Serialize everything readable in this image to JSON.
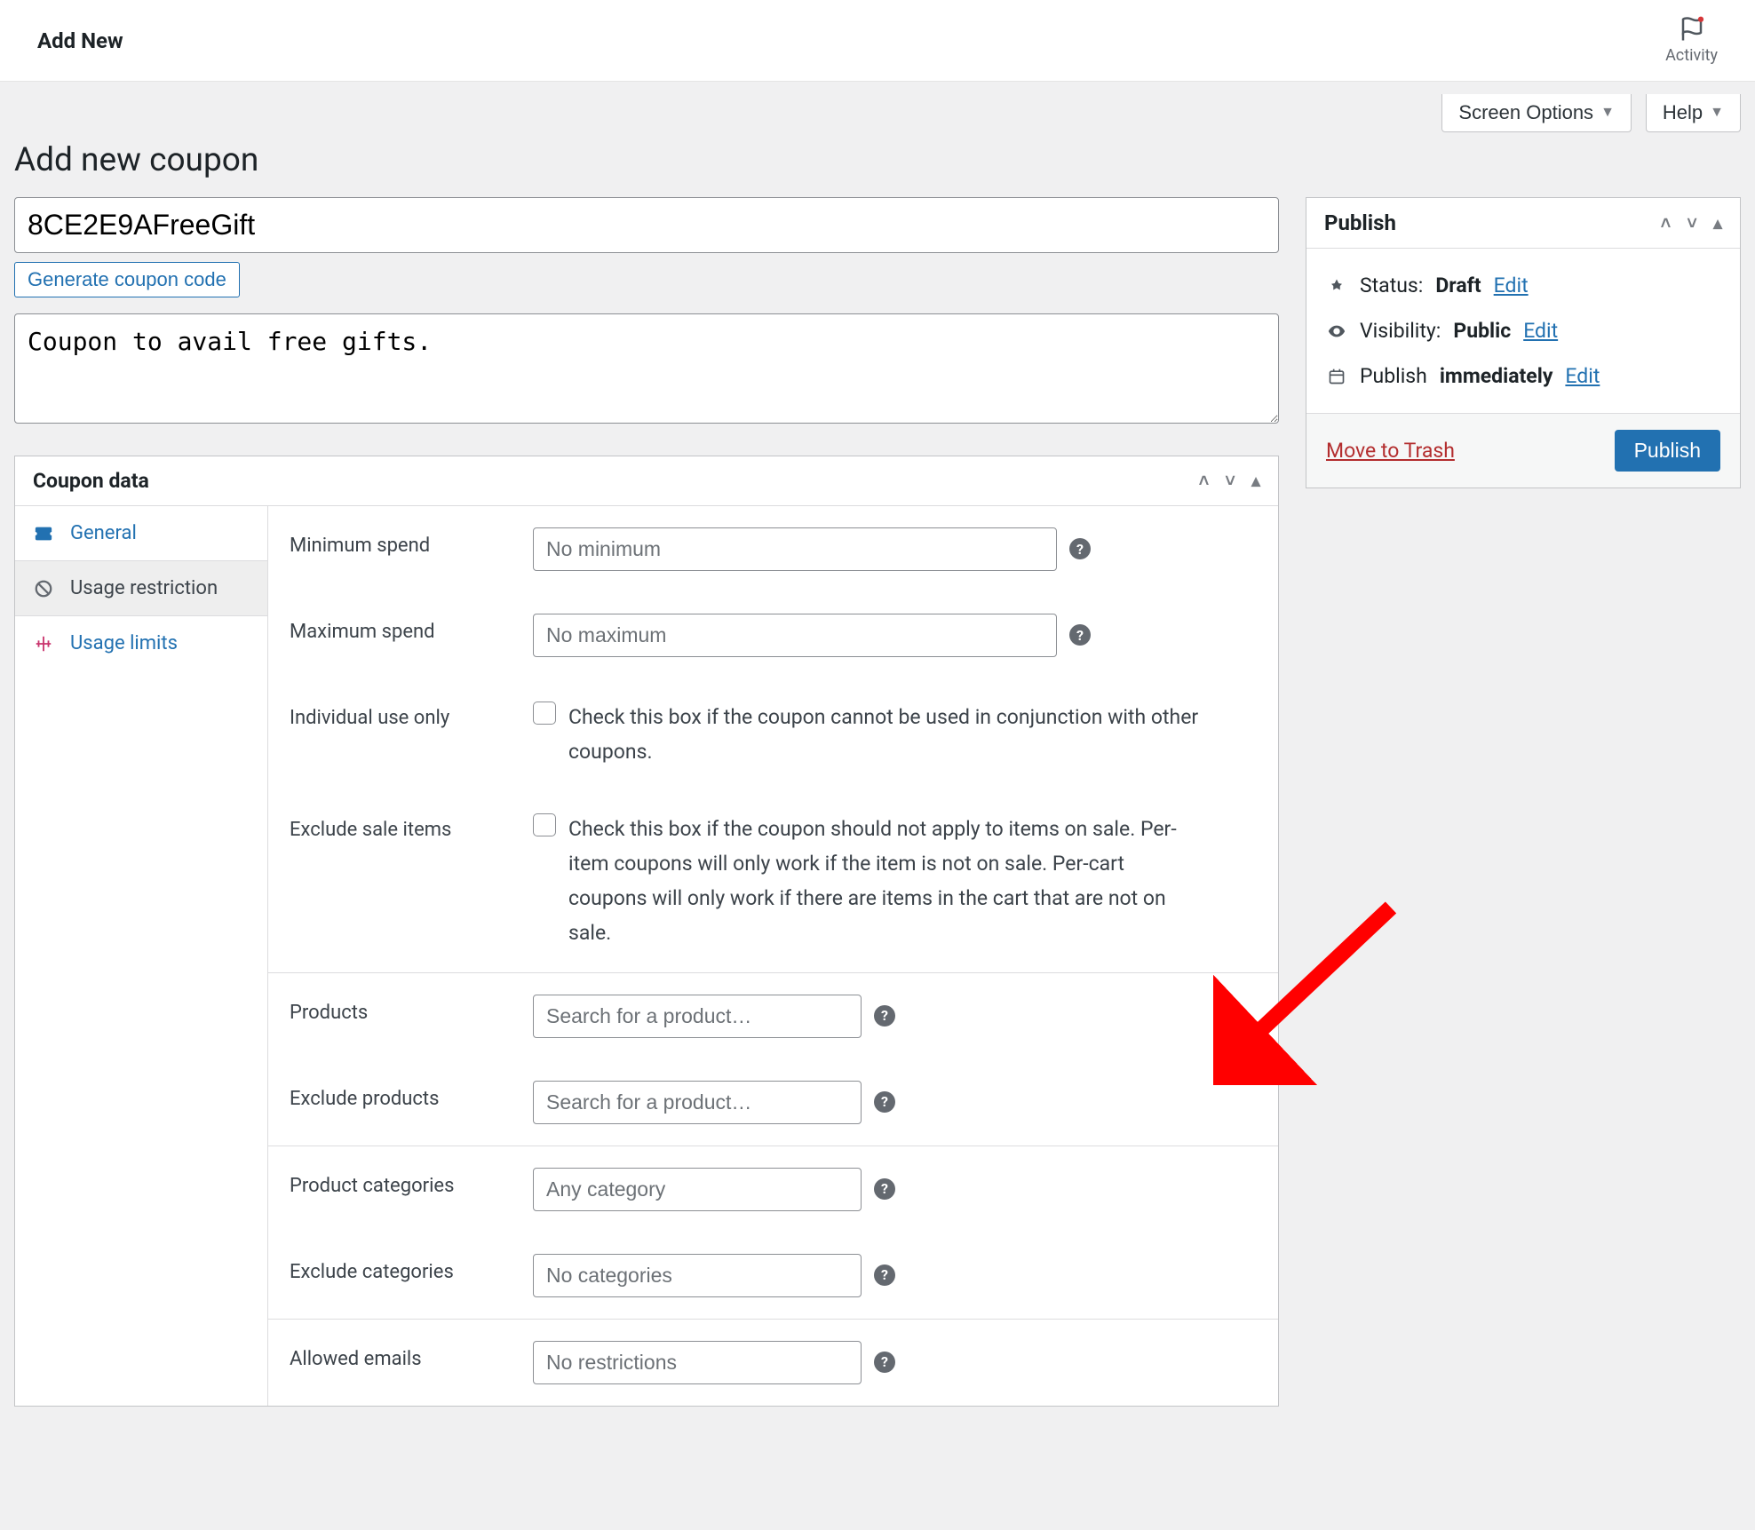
{
  "topbar": {
    "title": "Add New",
    "activity_label": "Activity"
  },
  "top_buttons": {
    "screen_options": "Screen Options",
    "help": "Help"
  },
  "page_heading": "Add new coupon",
  "coupon_code_value": "8CE2E9AFreeGift",
  "generate_button": "Generate coupon code",
  "description_value": "Coupon to avail free gifts.",
  "coupon_data": {
    "panel_title": "Coupon data",
    "tabs": {
      "general": "General",
      "usage_restriction": "Usage restriction",
      "usage_limits": "Usage limits"
    },
    "fields": {
      "minimum_spend": {
        "label": "Minimum spend",
        "placeholder": "No minimum"
      },
      "maximum_spend": {
        "label": "Maximum spend",
        "placeholder": "No maximum"
      },
      "individual_use": {
        "label": "Individual use only",
        "desc": "Check this box if the coupon cannot be used in conjunction with other coupons."
      },
      "exclude_sale": {
        "label": "Exclude sale items",
        "desc": "Check this box if the coupon should not apply to items on sale. Per-item coupons will only work if the item is not on sale. Per-cart coupons will only work if there are items in the cart that are not on sale."
      },
      "products": {
        "label": "Products",
        "placeholder": "Search for a product…"
      },
      "exclude_products": {
        "label": "Exclude products",
        "placeholder": "Search for a product…"
      },
      "product_categories": {
        "label": "Product categories",
        "placeholder": "Any category"
      },
      "exclude_categories": {
        "label": "Exclude categories",
        "placeholder": "No categories"
      },
      "allowed_emails": {
        "label": "Allowed emails",
        "placeholder": "No restrictions"
      }
    }
  },
  "publish": {
    "title": "Publish",
    "status_label": "Status:",
    "status_value": "Draft",
    "visibility_label": "Visibility:",
    "visibility_value": "Public",
    "schedule_label": "Publish",
    "schedule_value": "immediately",
    "edit": "Edit",
    "move_to_trash": "Move to Trash",
    "publish_button": "Publish"
  }
}
